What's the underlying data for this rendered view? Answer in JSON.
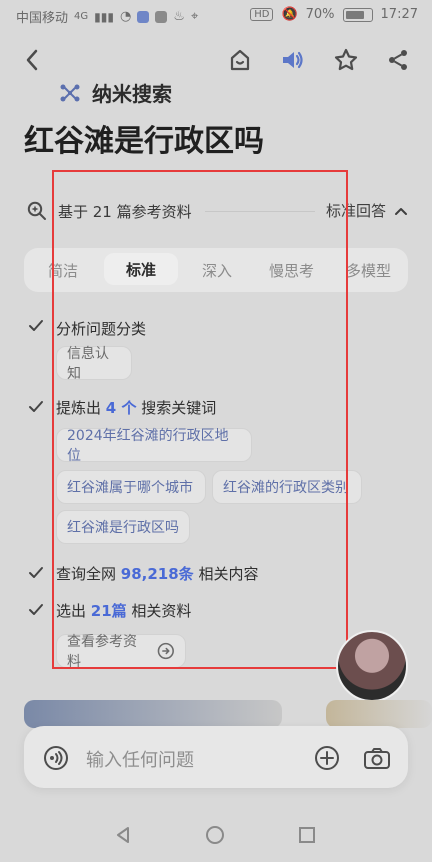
{
  "status_bar": {
    "carrier": "中国移动",
    "signal": "4G",
    "battery": "70%",
    "time": "17:27"
  },
  "header": {
    "brand": "纳米搜索"
  },
  "page": {
    "title": "红谷滩是行政区吗"
  },
  "reference": {
    "text": "基于 21 篇参考资料",
    "mode": "标准回答"
  },
  "tabs": [
    "简洁",
    "标准",
    "深入",
    "慢思考",
    "多模型"
  ],
  "steps": {
    "s1": {
      "label": "分析问题分类",
      "chip": "信息认知"
    },
    "s2": {
      "prefix": "提炼出 ",
      "count": "4 个",
      "suffix": " 搜索关键词",
      "keywords": [
        "2024年红谷滩的行政区地位",
        "红谷滩属于哪个城市",
        "红谷滩的行政区类别",
        "红谷滩是行政区吗"
      ]
    },
    "s3": {
      "prefix": "查询全网 ",
      "count": "98,218条",
      "suffix": " 相关内容"
    },
    "s4": {
      "prefix": "选出 ",
      "count": "21篇",
      "suffix": " 相关资料",
      "button": "查看参考资料"
    }
  },
  "input": {
    "placeholder": "输入任何问题"
  }
}
